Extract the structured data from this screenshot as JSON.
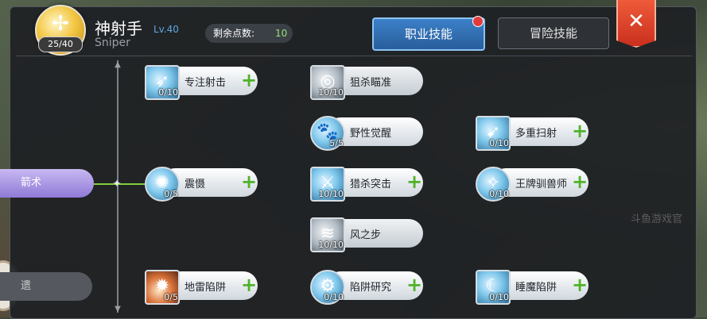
{
  "header": {
    "badge_icon": "crossbow-icon",
    "skill_points_used": "25/40",
    "job_name": "神射手",
    "job_level": "Lv.40",
    "job_name_en": "Sniper",
    "remaining_points_label": "剩余点数:",
    "remaining_points_value": "10"
  },
  "tabs": [
    {
      "label": "职业技能",
      "active": true,
      "has_notification": true
    },
    {
      "label": "冒险技能",
      "active": false
    }
  ],
  "close_label": "✕",
  "prev_class_skills": [
    {
      "label": "箭术"
    },
    {
      "label": "遗"
    }
  ],
  "skills": [
    {
      "name": "专注射击",
      "level": "0/10",
      "icon": "focus-shot-icon"
    },
    {
      "name": "狙杀瞄准",
      "level": "10/10",
      "icon": "sniper-aim-icon"
    },
    {
      "name": "野性觉醒",
      "level": "5/5",
      "icon": "paw-icon"
    },
    {
      "name": "多重扫射",
      "level": "0/10",
      "icon": "multi-shot-icon"
    },
    {
      "name": "震慑",
      "level": "0/5",
      "icon": "stun-icon"
    },
    {
      "name": "猎杀突击",
      "level": "10/10",
      "icon": "hunt-assault-icon"
    },
    {
      "name": "王牌驯兽师",
      "level": "0/10",
      "icon": "beast-master-icon"
    },
    {
      "name": "风之步",
      "level": "10/10",
      "icon": "wind-step-icon"
    },
    {
      "name": "地雷陷阱",
      "level": "0/5",
      "icon": "mine-trap-icon"
    },
    {
      "name": "陷阱研究",
      "level": "0/10",
      "icon": "trap-research-icon"
    },
    {
      "name": "睡魔陷阱",
      "level": "0/10",
      "icon": "sleep-trap-icon"
    }
  ],
  "watermark": "斗鱼游戏官",
  "colors": {
    "tab_active": "#3c80c8",
    "close_button": "#e04a2e",
    "plus": "#4fb32a",
    "level_text": "#5fa7e0",
    "points_value": "#9fe07a"
  }
}
